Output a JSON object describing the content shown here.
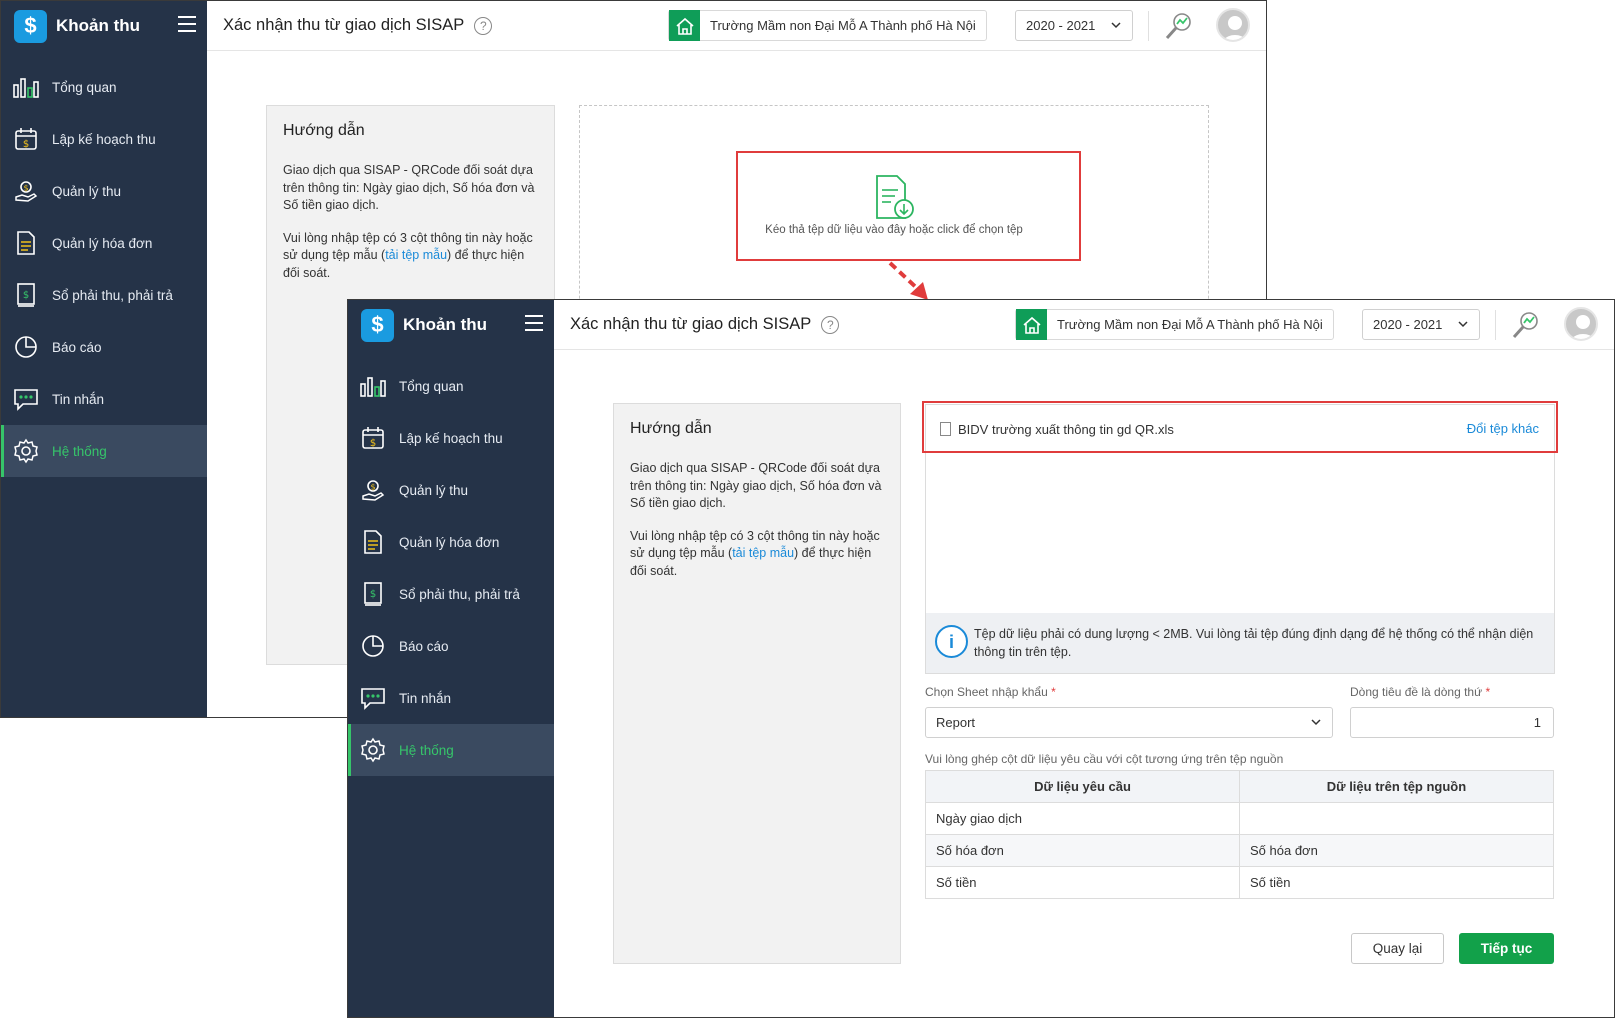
{
  "app": {
    "name": "Khoản thu",
    "logo_symbol": "$",
    "page_title": "Xác nhận thu từ giao dịch SISAP",
    "help_symbol": "?",
    "school_name": "Trường Mầm non Đại Mỗ A Thành phố Hà Nội",
    "school_year": "2020 - 2021",
    "accent": "#36c56a",
    "sidebar_bg": "#253348"
  },
  "sidebar": {
    "items": [
      {
        "label": "Tổng quan",
        "icon": "bar-chart-icon"
      },
      {
        "label": "Lập kế hoạch thu",
        "icon": "calendar-money-icon"
      },
      {
        "label": "Quản lý thu",
        "icon": "hand-coin-icon"
      },
      {
        "label": "Quản lý hóa đơn",
        "icon": "invoice-icon"
      },
      {
        "label": "Sổ phải thu, phải trả",
        "icon": "ledger-icon"
      },
      {
        "label": "Báo cáo",
        "icon": "pie-chart-icon"
      },
      {
        "label": "Tin nhắn",
        "icon": "message-icon"
      },
      {
        "label": "Hệ thống",
        "icon": "gear-icon",
        "active": true
      }
    ]
  },
  "guide": {
    "title": "Hướng dẫn",
    "para1": "Giao dịch qua SISAP - QRCode đối soát dựa trên thông tin: Ngày giao dịch, Số hóa đơn và Số tiền giao dịch.",
    "para2_before": "Vui lòng nhập tệp có 3 cột thông tin này hoặc sử dụng tệp mẫu (",
    "para2_link": "tải tệp mẫu",
    "para2_after": ") để thực hiện đối soát."
  },
  "upload": {
    "drop_text": "Kéo thả tệp dữ liệu vào đây hoặc click để chọn tệp"
  },
  "file": {
    "name": "BIDV trường xuất thông tin gd QR.xls",
    "change_label": "Đổi tệp khác",
    "info_icon": "i",
    "info_text": "Tệp dữ liệu phải có dung lượng < 2MB. Vui lòng tải tệp đúng định dạng để hệ thống có thể nhận diện thông tin trên tệp."
  },
  "form": {
    "sheet_label": "Chọn Sheet nhập khẩu",
    "sheet_value": "Report",
    "header_row_label": "Dòng tiêu đề là dòng thứ",
    "header_row_value": "1",
    "required_mark": "*",
    "mapping_hint": "Vui lòng ghép cột dữ liệu yêu cầu với cột tương ứng trên tệp nguồn"
  },
  "mapping": {
    "headers": [
      "Dữ liệu yêu cầu",
      "Dữ liệu trên tệp nguồn"
    ],
    "rows": [
      [
        "Ngày giao dịch",
        ""
      ],
      [
        "Số hóa đơn",
        "Số hóa đơn"
      ],
      [
        "Số tiền",
        "Số tiền"
      ]
    ]
  },
  "buttons": {
    "back": "Quay lại",
    "next": "Tiếp tục"
  }
}
